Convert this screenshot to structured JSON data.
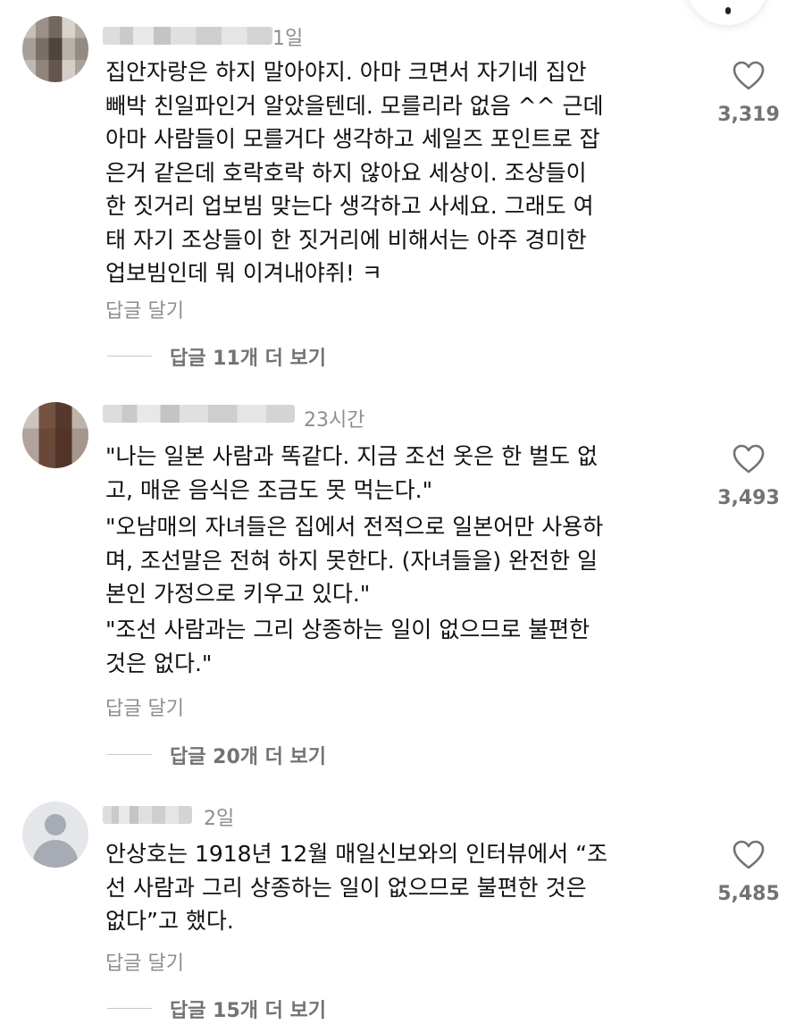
{
  "comments": [
    {
      "time": "1일",
      "text": "집안자랑은 하지 말아야지. 아마 크면서 자기네 집안\n빼박 친일파인거 알았을텐데. 모를리라 없음 ^^ 근데\n아마 사람들이 모를거다 생각하고 세일즈 포인트로 잡\n은거 같은데 호락호락 하지 않아요 세상이. 조상들이\n한 짓거리 업보빔 맞는다 생각하고 사세요. 그래도 여\n태 자기 조상들이 한 짓거리에 비해서는 아주 경미한\n업보빔인데 뭐 이겨내야쥐! ㅋ",
      "reply_action": "답글 달기",
      "view_replies": "답글 11개 더 보기",
      "likes": "3,319",
      "avatar": "blurred-photo"
    },
    {
      "time": "23시간",
      "paragraphs": [
        "\"나는 일본 사람과 똑같다. 지금 조선 옷은 한 벌도 없\n고, 매운 음식은 조금도 못 먹는다.\"",
        "\"오남매의 자녀들은 집에서 전적으로 일본어만 사용하\n며, 조선말은 전혀 하지 못한다. (자녀들을) 완전한 일\n본인 가정으로 키우고 있다.\"",
        "\"조선 사람과는 그리 상종하는 일이 없으므로 불편한\n것은 없다.\""
      ],
      "reply_action": "답글 달기",
      "view_replies": "답글 20개 더 보기",
      "likes": "3,493",
      "avatar": "blurred-photo"
    },
    {
      "time": "2일",
      "text": "안상호는 1918년 12월 매일신보와의 인터뷰에서 “조\n선 사람과 그리 상종하는 일이 없으므로 불편한 것은\n없다”고 했다.",
      "reply_action": "답글 달기",
      "view_replies": "답글 15개 더 보기",
      "likes": "5,485",
      "avatar": "default-person-icon"
    }
  ],
  "colors": {
    "text": "#111111",
    "secondary": "#8e8e8e",
    "count": "#737373",
    "divider": "#c7c7c7"
  }
}
